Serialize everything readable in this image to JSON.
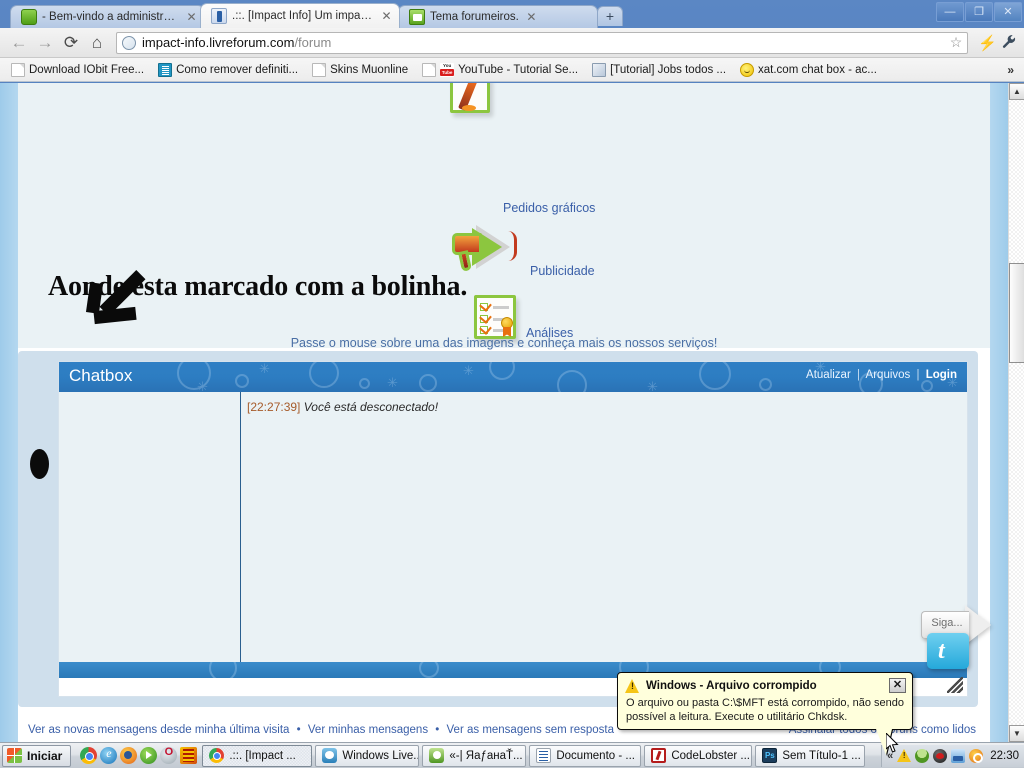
{
  "browser": {
    "tabs": [
      {
        "title": "- Bem-vindo a administraçã...",
        "favicon": "green-speech-bubble-icon",
        "active": false
      },
      {
        "title": ".::. [Impact Info] Um impac...",
        "favicon": "blue-book-icon",
        "active": true
      },
      {
        "title": "Tema forumeiros.",
        "favicon": "green-forum-icon",
        "active": false
      }
    ],
    "new_tab_label": "+",
    "window_controls": {
      "minimize": "—",
      "maximize": "❐",
      "close": "✕"
    },
    "nav": {
      "back": "←",
      "forward": "→",
      "reload": "⟳",
      "home": "⌂"
    },
    "omnibox": {
      "host": "impact-info.livreforum.com",
      "path": "/forum",
      "star": "☆"
    },
    "extensions": {
      "lightning": "⚡",
      "wrench": "🔧"
    },
    "bookmarks": [
      {
        "label": "Download IObit Free...",
        "icon": "page-icon"
      },
      {
        "label": "Como remover definiti...",
        "icon": "teal-article-icon"
      },
      {
        "label": "Skins Muonline",
        "icon": "page-icon"
      },
      {
        "label": "YouTube - Tutorial Se...",
        "icon": "youtube-icon"
      },
      {
        "label": "[Tutorial] Jobs todos ...",
        "icon": "book-icon"
      },
      {
        "label": "xat.com chat box - ac...",
        "icon": "smiley-icon"
      }
    ],
    "bookmarks_overflow": "»"
  },
  "page": {
    "headline": "Aonde esta marcado com a bolinha.",
    "services": [
      {
        "label": "Pedidos gráficos",
        "icon": "paper-and-pencil-icon"
      },
      {
        "label": "Publicidade",
        "icon": "megaphone-icon"
      },
      {
        "label": "Análises",
        "icon": "clipboard-checklist-icon"
      }
    ],
    "services_caption": "Passe o mouse sobre uma das imagens e conheça mais os nossos serviços!",
    "chatbox": {
      "title": "Chatbox",
      "actions": {
        "refresh": "Atualizar",
        "archives": "Arquivos",
        "login": "Login",
        "separator": "|"
      },
      "messages": [
        {
          "time": "[22:27:39]",
          "text": "Você está desconectado!"
        }
      ]
    },
    "footer": {
      "links": [
        "Ver as novas mensagens desde minha última visita",
        "Ver minhas mensagens",
        "Ver as mensagens sem resposta"
      ],
      "separator": "•",
      "right_link": "Assinalar todos os fóruns como lidos"
    },
    "twitter_widget": {
      "label": "Siga...",
      "bird": "t"
    }
  },
  "notification": {
    "title": "Windows - Arquivo corrompido",
    "body": "O arquivo ou pasta C:\\$MFT está corrompido, não sendo possível a leitura. Execute o utilitário Chkdsk.",
    "close": "✕",
    "icon": "warning-triangle-icon"
  },
  "taskbar": {
    "start_label": "Iniciar",
    "quicklaunch": [
      "chrome-icon",
      "ie-icon",
      "firefox-icon",
      "media-player-icon",
      "opera-icon",
      "red-app-icon"
    ],
    "windows": [
      {
        "label": ".::. [Impact ...",
        "icon": "chrome-icon",
        "active": true
      },
      {
        "label": "Windows Live...",
        "icon": "msn-icon",
        "active": false
      },
      {
        "label": "«-| ЯaƒaнaŤ...",
        "icon": "msn-contact-icon",
        "active": false
      },
      {
        "label": "Documento - ...",
        "icon": "word-icon",
        "active": false
      },
      {
        "label": "CodeLobster ...",
        "icon": "codelobster-icon",
        "active": false
      },
      {
        "label": "Sem Título-1 ...",
        "icon": "photoshop-icon",
        "active": false
      }
    ],
    "tray": {
      "chevron": "«",
      "icons": [
        "warning-icon",
        "user-icon",
        "antivirus-icon",
        "network-icon",
        "orange-app-icon"
      ],
      "clock": "22:30"
    }
  }
}
